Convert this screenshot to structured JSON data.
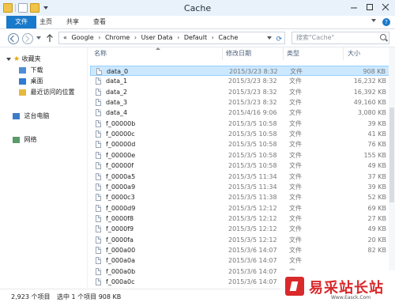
{
  "window": {
    "title": "Cache"
  },
  "ribbon": {
    "tabs": [
      "文件",
      "主页",
      "共享",
      "查看"
    ]
  },
  "address": {
    "prefix": "«",
    "crumbs": [
      "Google",
      "Chrome",
      "User Data",
      "Default",
      "Cache"
    ],
    "separator": "›"
  },
  "search": {
    "placeholder": "搜索\"Cache\""
  },
  "sidebar": {
    "favorites": "收藏夹",
    "downloads": "下载",
    "desktop": "桌面",
    "recent": "最近访问的位置",
    "thispc": "这台电脑",
    "network": "网络"
  },
  "columns": {
    "name": "名称",
    "date": "修改日期",
    "type": "类型",
    "size": "大小"
  },
  "files": [
    {
      "name": "data_0",
      "date": "2015/3/23 8:32",
      "type": "文件",
      "size": "908 KB"
    },
    {
      "name": "data_1",
      "date": "2015/3/23 8:32",
      "type": "文件",
      "size": "16,232 KB"
    },
    {
      "name": "data_2",
      "date": "2015/3/23 8:32",
      "type": "文件",
      "size": "16,392 KB"
    },
    {
      "name": "data_3",
      "date": "2015/3/23 8:32",
      "type": "文件",
      "size": "49,160 KB"
    },
    {
      "name": "data_4",
      "date": "2015/4/16 9:06",
      "type": "文件",
      "size": "3,080 KB"
    },
    {
      "name": "f_00000b",
      "date": "2015/3/5 10:58",
      "type": "文件",
      "size": "39 KB"
    },
    {
      "name": "f_00000c",
      "date": "2015/3/5 10:58",
      "type": "文件",
      "size": "41 KB"
    },
    {
      "name": "f_00000d",
      "date": "2015/3/5 10:58",
      "type": "文件",
      "size": "76 KB"
    },
    {
      "name": "f_00000e",
      "date": "2015/3/5 10:58",
      "type": "文件",
      "size": "155 KB"
    },
    {
      "name": "f_00000f",
      "date": "2015/3/5 10:58",
      "type": "文件",
      "size": "49 KB"
    },
    {
      "name": "f_0000a5",
      "date": "2015/3/5 11:34",
      "type": "文件",
      "size": "37 KB"
    },
    {
      "name": "f_0000a9",
      "date": "2015/3/5 11:34",
      "type": "文件",
      "size": "39 KB"
    },
    {
      "name": "f_0000c3",
      "date": "2015/3/5 11:38",
      "type": "文件",
      "size": "52 KB"
    },
    {
      "name": "f_0000d9",
      "date": "2015/3/5 12:12",
      "type": "文件",
      "size": "69 KB"
    },
    {
      "name": "f_0000f8",
      "date": "2015/3/5 12:12",
      "type": "文件",
      "size": "27 KB"
    },
    {
      "name": "f_0000f9",
      "date": "2015/3/5 12:12",
      "type": "文件",
      "size": "49 KB"
    },
    {
      "name": "f_0000fa",
      "date": "2015/3/5 12:12",
      "type": "文件",
      "size": "20 KB"
    },
    {
      "name": "f_000a00",
      "date": "2015/3/6 14:07",
      "type": "文件",
      "size": "82 KB"
    },
    {
      "name": "f_000a0a",
      "date": "2015/3/6 14:07",
      "type": "文件",
      "size": ""
    },
    {
      "name": "f_000a0b",
      "date": "2015/3/6 14:07",
      "type": "文",
      "size": ""
    },
    {
      "name": "f_000a0c",
      "date": "2015/3/6 14:07",
      "type": "",
      "size": ""
    }
  ],
  "status": {
    "count": "2,923 个项目",
    "selected": "选中 1 个项目  908 KB"
  },
  "watermark": {
    "text": "易采站长站",
    "url": "Www.Easck.Com"
  }
}
